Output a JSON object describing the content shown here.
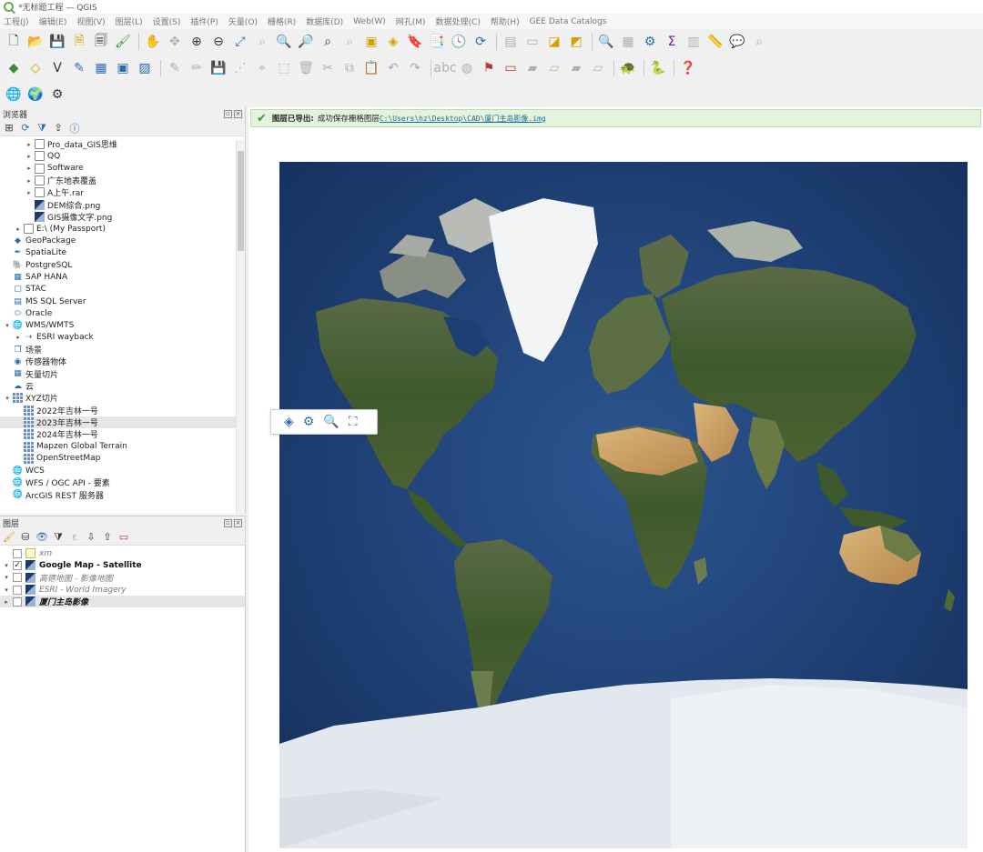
{
  "window": {
    "title": "*无标题工程 — QGIS"
  },
  "menu": [
    "工程(J)",
    "编辑(E)",
    "视图(V)",
    "图层(L)",
    "设置(S)",
    "插件(P)",
    "矢量(O)",
    "栅格(R)",
    "数据库(D)",
    "Web(W)",
    "网孔(M)",
    "数据处理(C)",
    "帮助(H)",
    "GEE Data Catalogs"
  ],
  "browser": {
    "title": "浏览器",
    "items": [
      {
        "label": "Pro_data_GIS思维",
        "icon": "folder-icon",
        "indent": 2,
        "arrow": "▸"
      },
      {
        "label": "QQ",
        "icon": "folder-icon",
        "indent": 2,
        "arrow": "▸"
      },
      {
        "label": "Software",
        "icon": "folder-icon",
        "indent": 2,
        "arrow": "▸"
      },
      {
        "label": "广东地表覆盖",
        "icon": "folder-icon",
        "indent": 2,
        "arrow": "▸"
      },
      {
        "label": "A上午.rar",
        "icon": "archive-icon",
        "indent": 2,
        "arrow": "▸"
      },
      {
        "label": "DEM综合.png",
        "icon": "raster-icon",
        "indent": 2,
        "arrow": ""
      },
      {
        "label": "GIS摄像文字.png",
        "icon": "raster-icon",
        "indent": 2,
        "arrow": ""
      },
      {
        "label": "E:\\ (My Passport)",
        "icon": "drive-icon",
        "indent": 1,
        "arrow": "▸"
      },
      {
        "label": "GeoPackage",
        "icon": "geopackage-icon",
        "indent": 0,
        "arrow": ""
      },
      {
        "label": "SpatiaLite",
        "icon": "spatialite-icon",
        "indent": 0,
        "arrow": ""
      },
      {
        "label": "PostgreSQL",
        "icon": "postgresql-icon",
        "indent": 0,
        "arrow": ""
      },
      {
        "label": "SAP HANA",
        "icon": "hana-icon",
        "indent": 0,
        "arrow": ""
      },
      {
        "label": "STAC",
        "icon": "stac-icon",
        "indent": 0,
        "arrow": ""
      },
      {
        "label": "MS SQL Server",
        "icon": "mssql-icon",
        "indent": 0,
        "arrow": ""
      },
      {
        "label": "Oracle",
        "icon": "oracle-icon",
        "indent": 0,
        "arrow": ""
      },
      {
        "label": "WMS/WMTS",
        "icon": "globe-icon",
        "indent": 0,
        "arrow": "▾"
      },
      {
        "label": "ESRI wayback",
        "icon": "wms-connection-icon",
        "indent": 1,
        "arrow": "▸"
      },
      {
        "label": "场景",
        "icon": "scene-icon",
        "indent": 0,
        "arrow": ""
      },
      {
        "label": "传感器物体",
        "icon": "sensor-icon",
        "indent": 0,
        "arrow": ""
      },
      {
        "label": "矢量切片",
        "icon": "vector-tile-icon",
        "indent": 0,
        "arrow": ""
      },
      {
        "label": "云",
        "icon": "cloud-icon",
        "indent": 0,
        "arrow": ""
      },
      {
        "label": "XYZ切片",
        "icon": "grid-icon",
        "indent": 0,
        "arrow": "▾"
      },
      {
        "label": "2022年吉林一号",
        "icon": "grid-icon",
        "indent": 1,
        "arrow": ""
      },
      {
        "label": "2023年吉林一号",
        "icon": "grid-icon",
        "indent": 1,
        "arrow": "",
        "highlight": true
      },
      {
        "label": "2024年吉林一号",
        "icon": "grid-icon",
        "indent": 1,
        "arrow": ""
      },
      {
        "label": "Mapzen Global Terrain",
        "icon": "grid-icon",
        "indent": 1,
        "arrow": ""
      },
      {
        "label": "OpenStreetMap",
        "icon": "grid-icon",
        "indent": 1,
        "arrow": ""
      },
      {
        "label": "WCS",
        "icon": "globe-icon",
        "indent": 0,
        "arrow": ""
      },
      {
        "label": "WFS / OGC API - 要素",
        "icon": "globe-icon",
        "indent": 0,
        "arrow": ""
      },
      {
        "label": "ArcGIS REST 服务器",
        "icon": "globe-icon",
        "indent": 0,
        "arrow": ""
      }
    ]
  },
  "layers": {
    "title": "图层",
    "items": [
      {
        "label": "xm",
        "checked": false,
        "style": "italic-g",
        "arrow": "",
        "icon": "polygon-layer-icon"
      },
      {
        "label": "Google Map - Satellite",
        "checked": true,
        "style": "bold",
        "arrow": "▾",
        "icon": "raster-layer-icon"
      },
      {
        "label": "高德地图 - 影像地图",
        "checked": false,
        "style": "italic-g",
        "arrow": "▾",
        "icon": "raster-layer-icon"
      },
      {
        "label": "ESRI - World Imagery",
        "checked": false,
        "style": "italic-g",
        "arrow": "▾",
        "icon": "raster-layer-icon"
      },
      {
        "label": "厦门主岛影像",
        "checked": false,
        "style": "bold-it",
        "arrow": "▸",
        "icon": "raster-layer-icon",
        "highlight": true
      }
    ]
  },
  "message": {
    "title": "图层已导出:",
    "text": "成功保存栅格图层",
    "link": "C:\\Users\\hz\\Desktop\\CAD\\厦门主岛影像.img"
  },
  "colors": {
    "accent": "#2b6cb0",
    "success": "#3a9a3a",
    "ocean": "#1d3c70",
    "land": "#3f5e2f",
    "desert": "#c9a262",
    "ice": "#e9eef3"
  }
}
